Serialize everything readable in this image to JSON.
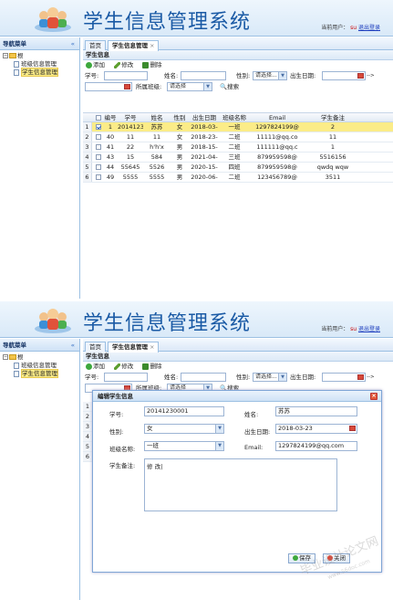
{
  "app": {
    "title": "学生信息管理系统",
    "user_label": "当前用户：",
    "user_name": "su",
    "logout": "退出登录"
  },
  "nav": {
    "header": "导航菜单",
    "collapse_glyph": "«",
    "root": "根",
    "items": [
      {
        "label": "班级信息管理",
        "selected": false
      },
      {
        "label": "学生信息管理",
        "selected": true
      }
    ]
  },
  "tabs": [
    {
      "label": "首页",
      "active": false
    },
    {
      "label": "学生信息管理",
      "active": true,
      "close": "×"
    }
  ],
  "panel": {
    "title": "学生信息",
    "toolbar": {
      "add": "添加",
      "edit": "修改",
      "delete": "删除"
    },
    "search": {
      "stu_no_label": "学号:",
      "name_label": "姓名:",
      "sex_label": "性别:",
      "sex_value": "请选择...",
      "birth_label": "出生日期:",
      "birth_arrow": "-->",
      "class_label": "所属班级:",
      "class_value": "请选择",
      "search_btn": "搜索"
    }
  },
  "grid": {
    "columns": [
      "",
      "编号",
      "学号",
      "姓名",
      "性别",
      "出生日期",
      "班级名称",
      "Email",
      "学生备注"
    ],
    "rows": [
      {
        "rn": "1",
        "checked": true,
        "selected": true,
        "id": "1",
        "stu_no": "2014123",
        "name": "苏苏",
        "sex": "女",
        "birth": "2018-03-",
        "cls": "一班",
        "email": "1297824199@",
        "remark": "2"
      },
      {
        "rn": "2",
        "checked": false,
        "selected": false,
        "id": "40",
        "stu_no": "11",
        "name": "11",
        "sex": "女",
        "birth": "2018-23-",
        "cls": "二班",
        "email": "11111@qq.co",
        "remark": "11"
      },
      {
        "rn": "3",
        "checked": false,
        "selected": false,
        "id": "41",
        "stu_no": "22",
        "name": "h'h'x",
        "sex": "男",
        "birth": "2018-15-",
        "cls": "二班",
        "email": "111111@qq.c",
        "remark": "1"
      },
      {
        "rn": "4",
        "checked": false,
        "selected": false,
        "id": "43",
        "stu_no": "15",
        "name": "584",
        "sex": "男",
        "birth": "2021-04-",
        "cls": "三班",
        "email": "879959598@",
        "remark": "5516156"
      },
      {
        "rn": "5",
        "checked": false,
        "selected": false,
        "id": "44",
        "stu_no": "55645",
        "name": "5526",
        "sex": "男",
        "birth": "2020-15-",
        "cls": "四班",
        "email": "879959598@",
        "remark": "qwdq wqw"
      },
      {
        "rn": "6",
        "checked": false,
        "selected": false,
        "id": "49",
        "stu_no": "5555",
        "name": "5555",
        "sex": "男",
        "birth": "2020-06-",
        "cls": "二班",
        "email": "123456789@",
        "remark": "3511"
      }
    ]
  },
  "dialog": {
    "title": "编辑学生信息",
    "stu_no_label": "学号:",
    "stu_no": "20141230001",
    "name_label": "姓名:",
    "name": "苏苏",
    "sex_label": "性别:",
    "sex": "女",
    "birth_label": "出生日期:",
    "birth": "2018-03-23",
    "class_label": "班级名称:",
    "class": "一班",
    "email_label": "Email:",
    "email": "1297824199@qq.com",
    "remark_label": "学生备注:",
    "remark": "修 改|",
    "save": "保存",
    "close": "关闭",
    "bg_rows": [
      "1",
      "2",
      "3",
      "4",
      "5",
      "6"
    ]
  },
  "watermark": {
    "text": "毕业设计论文网",
    "url": "www.56doc.com"
  },
  "colors": {
    "title_blue": "#1a5aa5",
    "selected_row": "#fbec88",
    "border_blue": "#9cc0e3"
  }
}
